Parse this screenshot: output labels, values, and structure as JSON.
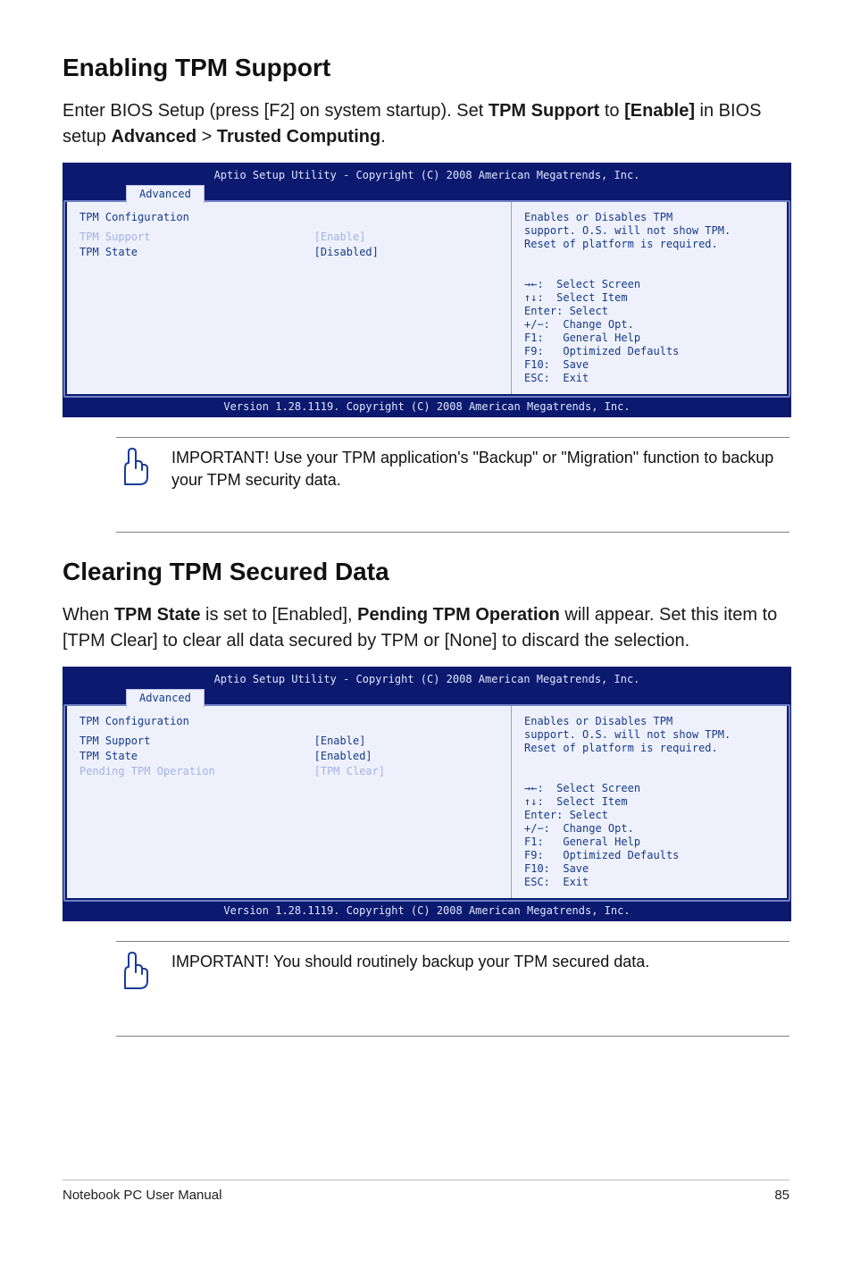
{
  "h1_enable": "Enabling TPM Support",
  "p_enable_pre": "Enter BIOS Setup (press [F2] on system startup). Set ",
  "p_enable_b1": "TPM Support",
  "p_enable_mid": " to ",
  "p_enable_b2": "[Enable]",
  "p_enable_mid2": " in BIOS setup ",
  "p_enable_b3": "Advanced",
  "p_enable_gt": " > ",
  "p_enable_b4": "Trusted Computing",
  "p_enable_end": ".",
  "bios": {
    "header": "Aptio Setup Utility - Copyright (C) 2008 American Megatrends, Inc.",
    "tab": "Advanced",
    "footer": "Version 1.28.1119. Copyright (C) 2008 American Megatrends, Inc.",
    "left_title": "TPM Configuration",
    "desc_l1": "Enables or Disables TPM",
    "desc_l2": "support. O.S. will not show TPM.",
    "desc_l3": "Reset of platform is required.",
    "keys": {
      "k1": "→←:  Select Screen",
      "k2": "↑↓:  Select Item",
      "k3": "Enter: Select",
      "k4": "+/−:  Change Opt.",
      "k5": "F1:   General Help",
      "k6": "F9:   Optimized Defaults",
      "k7": "F10:  Save",
      "k8": "ESC:  Exit"
    }
  },
  "bios1": {
    "r1_lbl": "TPM Support",
    "r1_val": "[Enable]",
    "r2_lbl": "TPM State",
    "r2_val": "[Disabled]"
  },
  "notice1": "IMPORTANT! Use your TPM application's \"Backup\" or \"Migration\" function to backup your TPM security data.",
  "h1_clear": "Clearing TPM Secured Data",
  "p_clear_pre": "When ",
  "p_clear_b1": "TPM State",
  "p_clear_mid1": " is set to [Enabled], ",
  "p_clear_b2": "Pending TPM Operation",
  "p_clear_mid2": " will appear. Set this item to [TPM Clear] to clear all data secured by TPM or [None] to discard the selection.",
  "bios2": {
    "r1_lbl": "TPM Support",
    "r1_val": "[Enable]",
    "r2_lbl": "TPM State",
    "r2_val": "[Enabled]",
    "r3_lbl": "Pending TPM Operation",
    "r3_val": "[TPM Clear]"
  },
  "notice2": "IMPORTANT! You should routinely backup your TPM secured data.",
  "footer_left": "Notebook PC User Manual",
  "footer_right": "85"
}
